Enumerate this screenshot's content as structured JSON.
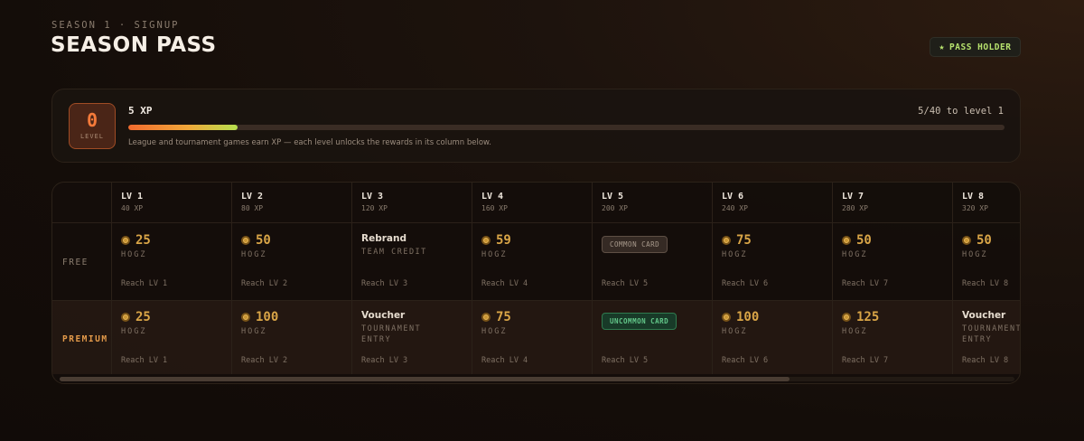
{
  "header": {
    "eyebrow": "SEASON 1 · SIGNUP",
    "title": "SEASON PASS",
    "badge": "PASS HOLDER",
    "badge_icon": "star-icon"
  },
  "progress": {
    "level": "0",
    "level_label": "LEVEL",
    "xp": "5 XP",
    "next": "5/40 to level 1",
    "fraction": 0.125,
    "note": "League and tournament games earn XP — each level unlocks the rewards in its column below."
  },
  "rows": {
    "free_label": "FREE",
    "premium_label": "PREMIUM"
  },
  "columns": [
    {
      "lv": "LV 1",
      "xp": "40 XP",
      "free": {
        "kind": "coin",
        "amount": "25",
        "unit": "HOGZ"
      },
      "premium": {
        "kind": "coin",
        "amount": "25",
        "unit": "HOGZ"
      },
      "reach": "Reach LV 1"
    },
    {
      "lv": "LV 2",
      "xp": "80 XP",
      "free": {
        "kind": "coin",
        "amount": "50",
        "unit": "HOGZ"
      },
      "premium": {
        "kind": "coin",
        "amount": "100",
        "unit": "HOGZ"
      },
      "reach": "Reach LV 2"
    },
    {
      "lv": "LV 3",
      "xp": "120 XP",
      "free": {
        "kind": "item",
        "name": "Rebrand",
        "sub": "TEAM CREDIT"
      },
      "premium": {
        "kind": "item",
        "name": "Voucher",
        "sub": "TOURNAMENT ENTRY"
      },
      "reach": "Reach LV 3"
    },
    {
      "lv": "LV 4",
      "xp": "160 XP",
      "free": {
        "kind": "coin",
        "amount": "59",
        "unit": "HOGZ"
      },
      "premium": {
        "kind": "coin",
        "amount": "75",
        "unit": "HOGZ"
      },
      "reach": "Reach LV 4"
    },
    {
      "lv": "LV 5",
      "xp": "200 XP",
      "free": {
        "kind": "card",
        "label": "COMMON CARD",
        "rarity": "common"
      },
      "premium": {
        "kind": "card",
        "label": "UNCOMMON CARD",
        "rarity": "uncommon"
      },
      "reach": "Reach LV 5"
    },
    {
      "lv": "LV 6",
      "xp": "240 XP",
      "free": {
        "kind": "coin",
        "amount": "75",
        "unit": "HOGZ"
      },
      "premium": {
        "kind": "coin",
        "amount": "100",
        "unit": "HOGZ"
      },
      "reach": "Reach LV 6"
    },
    {
      "lv": "LV 7",
      "xp": "280 XP",
      "free": {
        "kind": "coin",
        "amount": "50",
        "unit": "HOGZ"
      },
      "premium": {
        "kind": "coin",
        "amount": "125",
        "unit": "HOGZ"
      },
      "reach": "Reach LV 7"
    },
    {
      "lv": "LV 8",
      "xp": "320 XP",
      "free": {
        "kind": "coin",
        "amount": "50",
        "unit": "HOGZ"
      },
      "premium": {
        "kind": "item",
        "name": "Voucher",
        "sub": "TOURNAMENT ENTRY"
      },
      "reach": "Reach LV 8"
    }
  ],
  "colors": {
    "accent_orange": "#f47a3a",
    "pass_green": "#b7e26d",
    "coin_gold": "#d9a547",
    "premium_label": "#e39a4a"
  }
}
